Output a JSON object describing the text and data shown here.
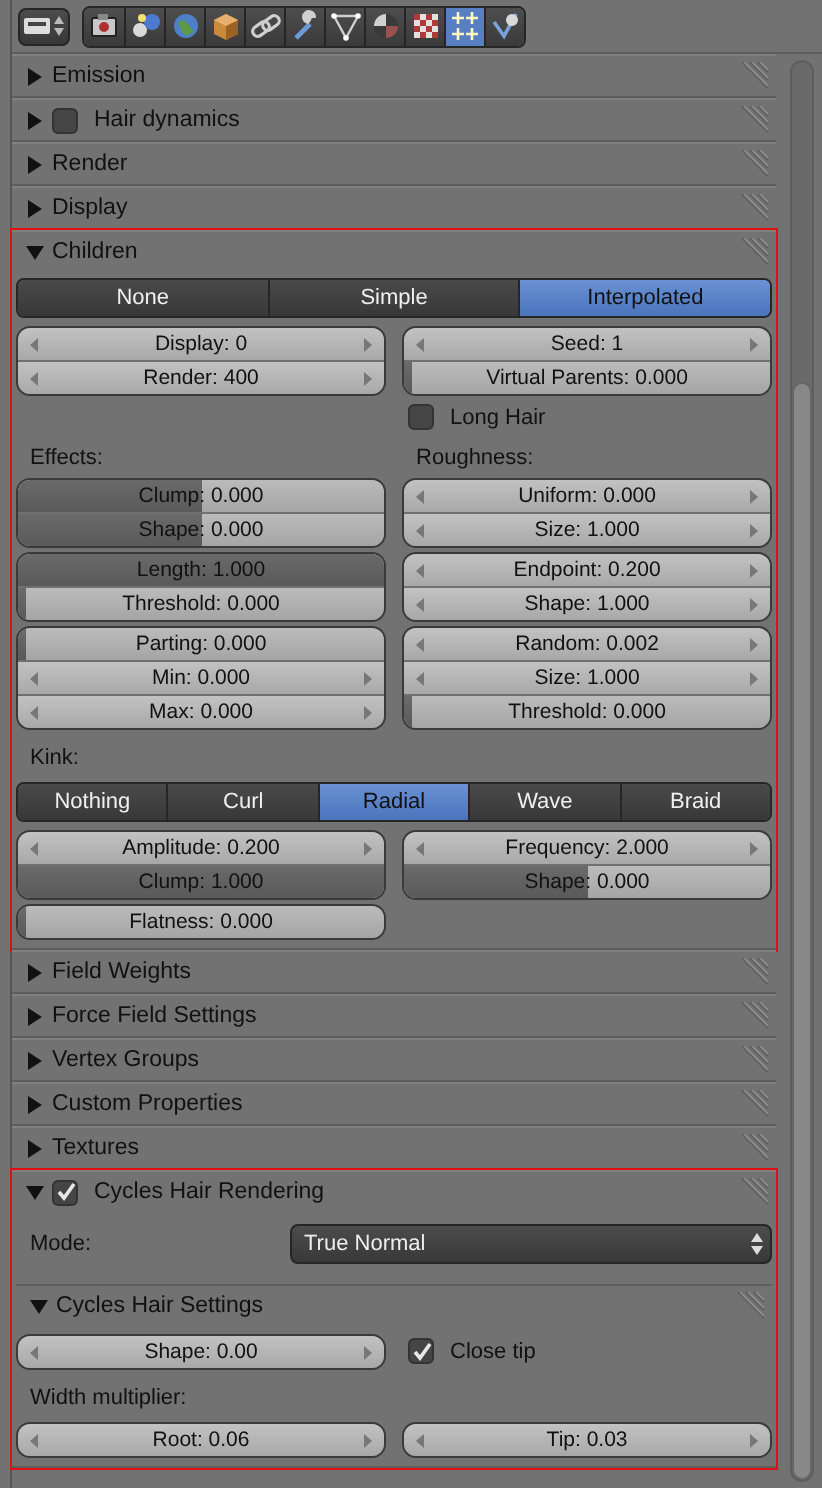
{
  "toolbar": {
    "tabs": [
      {
        "kind": "camera",
        "selected": false
      },
      {
        "kind": "layers",
        "selected": false
      },
      {
        "kind": "globe",
        "selected": false
      },
      {
        "kind": "cube",
        "selected": false
      },
      {
        "kind": "link",
        "selected": false
      },
      {
        "kind": "wrench",
        "selected": false
      },
      {
        "kind": "vertex",
        "selected": false
      },
      {
        "kind": "sphere",
        "selected": false
      },
      {
        "kind": "checker",
        "selected": false
      },
      {
        "kind": "sparkles",
        "selected": true
      },
      {
        "kind": "ball",
        "selected": false
      }
    ]
  },
  "panels": [
    {
      "title": "Emission",
      "expanded": false
    },
    {
      "title": "Hair dynamics",
      "expanded": false,
      "checkbox": {
        "checked": false
      }
    },
    {
      "title": "Render",
      "expanded": false
    },
    {
      "title": "Display",
      "expanded": false
    },
    {
      "title": "Children",
      "expanded": true,
      "highlighted": true,
      "body": [
        {
          "kind": "tabs",
          "options": [
            {
              "label": "None",
              "selected": false
            },
            {
              "label": "Simple",
              "selected": false
            },
            {
              "label": "Interpolated",
              "selected": true
            }
          ]
        },
        {
          "kind": "columns",
          "columns": [
            [
              {
                "kind": "group",
                "fields": [
                  {
                    "kind": "number",
                    "text": "Display: 0"
                  },
                  {
                    "kind": "number",
                    "text": "Render: 400"
                  }
                ]
              }
            ],
            [
              {
                "kind": "group",
                "fields": [
                  {
                    "kind": "number",
                    "text": "Seed: 1"
                  },
                  {
                    "kind": "slider",
                    "text": "Virtual Parents: 0.000",
                    "level": 0.02
                  }
                ]
              },
              {
                "kind": "checkbox",
                "label": "Long Hair",
                "checked": false
              }
            ]
          ]
        },
        {
          "kind": "columns",
          "columns": [
            [
              {
                "kind": "label",
                "text": "Effects:"
              },
              {
                "kind": "group",
                "fields": [
                  {
                    "kind": "slider",
                    "text": "Clump: 0.000",
                    "level": 0.5
                  },
                  {
                    "kind": "slider",
                    "text": "Shape: 0.000",
                    "level": 0.5
                  }
                ]
              },
              {
                "kind": "group",
                "fields": [
                  {
                    "kind": "slider",
                    "text": "Length: 1.000",
                    "level": 1
                  },
                  {
                    "kind": "slider",
                    "text": "Threshold: 0.000",
                    "level": 0.02
                  }
                ]
              },
              {
                "kind": "group",
                "fields": [
                  {
                    "kind": "slider",
                    "text": "Parting: 0.000",
                    "level": 0.02
                  },
                  {
                    "kind": "number",
                    "text": "Min: 0.000"
                  },
                  {
                    "kind": "number",
                    "text": "Max: 0.000"
                  }
                ]
              }
            ],
            [
              {
                "kind": "label",
                "text": "Roughness:"
              },
              {
                "kind": "group",
                "fields": [
                  {
                    "kind": "number",
                    "text": "Uniform: 0.000"
                  },
                  {
                    "kind": "number",
                    "text": "Size: 1.000"
                  }
                ]
              },
              {
                "kind": "group",
                "fields": [
                  {
                    "kind": "number",
                    "text": "Endpoint: 0.200"
                  },
                  {
                    "kind": "number",
                    "text": "Shape: 1.000"
                  }
                ]
              },
              {
                "kind": "group",
                "fields": [
                  {
                    "kind": "number",
                    "text": "Random: 0.002"
                  },
                  {
                    "kind": "number",
                    "text": "Size: 1.000"
                  },
                  {
                    "kind": "slider",
                    "text": "Threshold: 0.000",
                    "level": 0.02
                  }
                ]
              }
            ]
          ]
        },
        {
          "kind": "label",
          "text": "Kink:"
        },
        {
          "kind": "tabs",
          "options": [
            {
              "label": "Nothing",
              "selected": false
            },
            {
              "label": "Curl",
              "selected": false
            },
            {
              "label": "Radial",
              "selected": true
            },
            {
              "label": "Wave",
              "selected": false
            },
            {
              "label": "Braid",
              "selected": false
            }
          ]
        },
        {
          "kind": "columns",
          "columns": [
            [
              {
                "kind": "group",
                "fields": [
                  {
                    "kind": "number",
                    "text": "Amplitude: 0.200"
                  },
                  {
                    "kind": "slider",
                    "text": "Clump: 1.000",
                    "level": 1
                  }
                ]
              },
              {
                "kind": "group",
                "fields": [
                  {
                    "kind": "slider",
                    "text": "Flatness: 0.000",
                    "level": 0.02
                  }
                ]
              }
            ],
            [
              {
                "kind": "group",
                "fields": [
                  {
                    "kind": "number",
                    "text": "Frequency: 2.000"
                  },
                  {
                    "kind": "slider",
                    "text": "Shape: 0.000",
                    "level": 0.5
                  }
                ]
              }
            ]
          ]
        }
      ]
    },
    {
      "title": "Field Weights",
      "expanded": false
    },
    {
      "title": "Force Field Settings",
      "expanded": false
    },
    {
      "title": "Vertex Groups",
      "expanded": false
    },
    {
      "title": "Custom Properties",
      "expanded": false
    },
    {
      "title": "Textures",
      "expanded": false
    },
    {
      "title": "Cycles Hair Rendering",
      "expanded": true,
      "highlighted": true,
      "checkbox": {
        "checked": true
      },
      "body": [
        {
          "kind": "dropdown",
          "label": "Mode:",
          "value": "True Normal"
        },
        {
          "kind": "subpanel",
          "title": "Cycles Hair Settings",
          "expanded": true,
          "body": [
            {
              "kind": "columns",
              "columns": [
                [
                  {
                    "kind": "group",
                    "fields": [
                      {
                        "kind": "number",
                        "text": "Shape: 0.00"
                      }
                    ]
                  }
                ],
                [
                  {
                    "kind": "checkbox",
                    "label": "Close tip",
                    "checked": true
                  }
                ]
              ]
            },
            {
              "kind": "label",
              "text": "Width multiplier:"
            },
            {
              "kind": "columns",
              "columns": [
                [
                  {
                    "kind": "group",
                    "fields": [
                      {
                        "kind": "number",
                        "text": "Root: 0.06"
                      }
                    ]
                  }
                ],
                [
                  {
                    "kind": "group",
                    "fields": [
                      {
                        "kind": "number",
                        "text": "Tip: 0.03"
                      }
                    ]
                  }
                ]
              ]
            }
          ]
        }
      ]
    }
  ]
}
